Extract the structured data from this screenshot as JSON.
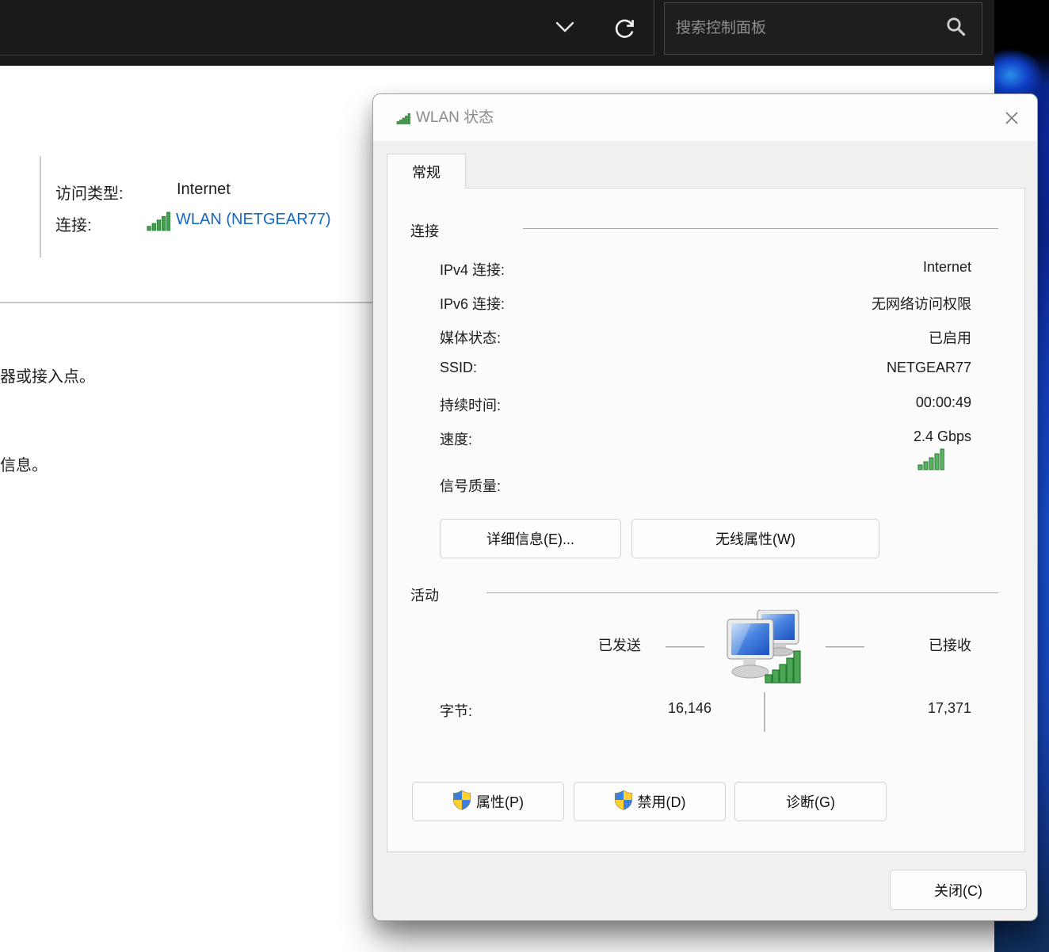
{
  "topbar": {
    "search_placeholder": "搜索控制面板",
    "icons": {
      "chevron": "chevron-down-icon",
      "refresh": "refresh-icon",
      "search": "search-icon"
    }
  },
  "background": {
    "access_type_label": "访问类型:",
    "access_type_value": "Internet",
    "connection_label": "连接:",
    "connection_link": "WLAN (NETGEAR77)",
    "fragment_top": "器或接入点。",
    "fragment_bottom": "信息。"
  },
  "dialog": {
    "title": "WLAN 状态",
    "tab": "常规",
    "connection": {
      "heading": "连接",
      "rows": [
        {
          "label": "IPv4 连接:",
          "value": "Internet"
        },
        {
          "label": "IPv6 连接:",
          "value": "无网络访问权限"
        },
        {
          "label": "媒体状态:",
          "value": "已启用"
        },
        {
          "label": "SSID:",
          "value": "NETGEAR77"
        },
        {
          "label": "持续时间:",
          "value": "00:00:49"
        },
        {
          "label": "速度:",
          "value": "2.4 Gbps"
        }
      ],
      "signal_quality_label": "信号质量:",
      "details_button": "详细信息(E)...",
      "wireless_button": "无线属性(W)"
    },
    "activity": {
      "heading": "活动",
      "sent_label": "已发送",
      "received_label": "已接收",
      "bytes_label": "字节:",
      "sent_value": "16,146",
      "received_value": "17,371",
      "properties_button": "属性(P)",
      "disable_button": "禁用(D)",
      "diagnose_button": "诊断(G)"
    },
    "close_button": "关闭(C)"
  },
  "colors": {
    "link_blue": "#1467c5",
    "signal_green": "#44a04f",
    "shield_blue": "#3b7fe0",
    "shield_yellow": "#ffd02e",
    "topbar_bg": "#1a1a1a"
  }
}
